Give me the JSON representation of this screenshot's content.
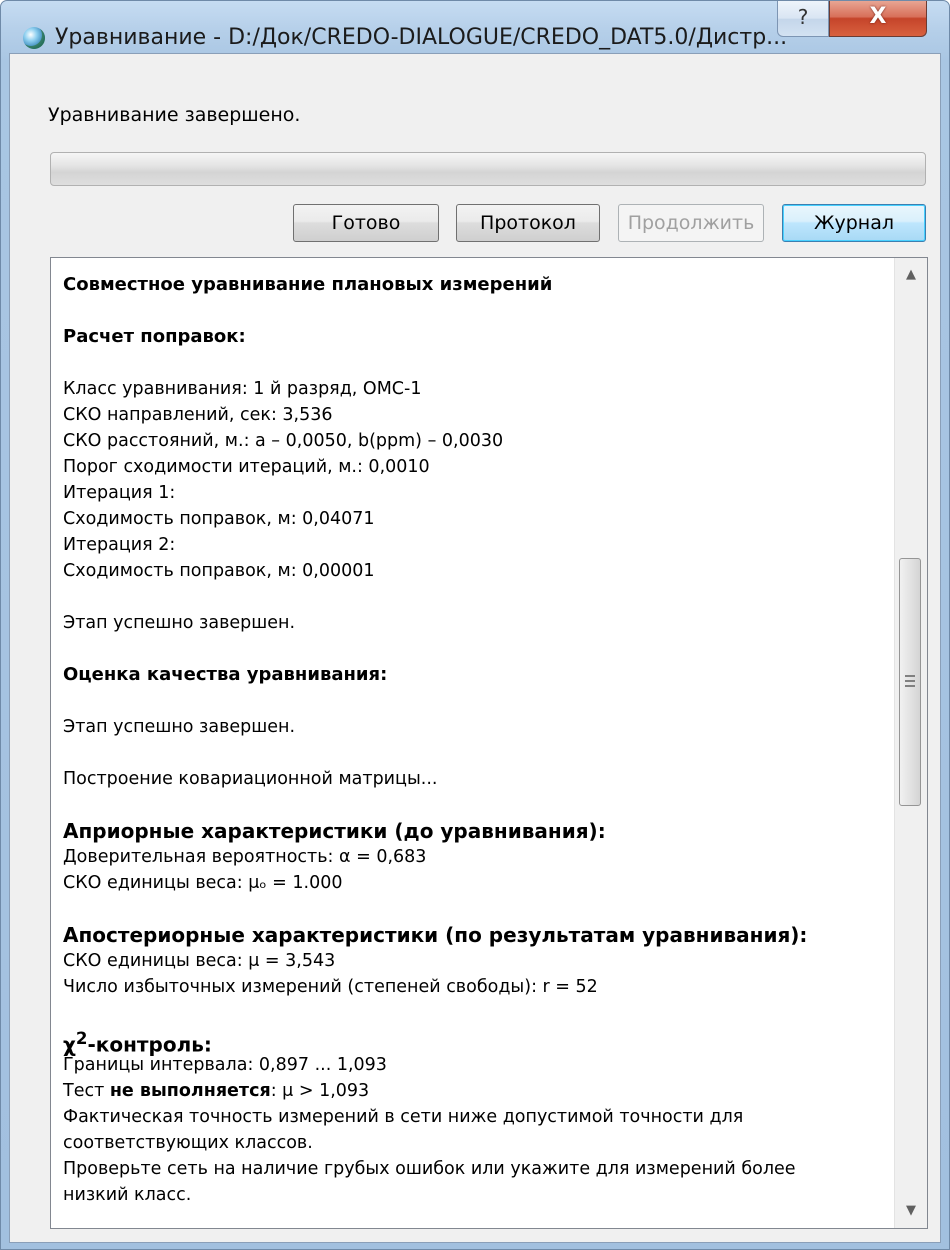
{
  "window": {
    "title": "Уравнивание - D:/Док/CREDO-DIALOGUE/CREDO_DAT5.0/Дистр...",
    "help_glyph": "?",
    "close_glyph": "X",
    "icon": "globe-icon"
  },
  "status": {
    "text": "Уравнивание завершено.",
    "progress_percent": 0
  },
  "buttons": {
    "done": "Готово",
    "protocol": "Протокол",
    "continue": "Продолжить",
    "journal": "Журнал"
  },
  "log": {
    "title": "Совместное уравнивание плановых измерений",
    "corrections_heading": "Расчет поправок:",
    "adjustment_class": "Класс уравнивания: 1 й разряд, ОМС-1",
    "sko_directions": "СКО направлений, сек: 3,536",
    "sko_distances": "СКО расстояний, м.: a – 0,0050, b(ppm) – 0,0030",
    "convergence_threshold": "Порог сходимости итераций, м.: 0,0010",
    "iteration1": "Итерация 1:",
    "convergence1": "Сходимость поправок, м: 0,04071",
    "iteration2": "Итерация 2:",
    "convergence2": "Сходимость поправок, м: 0,00001",
    "stage_done1": "Этап успешно завершен.",
    "quality_heading": "Оценка качества уравнивания:",
    "stage_done2": "Этап успешно завершен.",
    "covariance": "Построение ковариационной матрицы...",
    "apriori_heading": "Априорные характеристики (до уравнивания):",
    "confidence": "Доверительная вероятность: α = 0,683",
    "sko_unit_weight_prior": "СКО единицы веса: μₒ = 1.000",
    "aposteriori_heading": "Апостериорные характеристики (по результатам уравнивания):",
    "sko_unit_weight_post": "СКО единицы веса: μ = 3,543",
    "redundant": "Число избыточных измерений (степеней свободы): r = 52",
    "chi_heading_prefix": "χ",
    "chi_heading_sup": "2",
    "chi_heading_suffix": "-контроль:",
    "interval": "Границы интервала: 0,897 ... 1,093",
    "test_prefix": "Тест ",
    "test_bold": "не выполняется",
    "test_suffix": ": μ > 1,093",
    "note1": "Фактическая точность измерений в сети ниже допустимой точности для",
    "note2": "соответствующих классов.",
    "note3": "Проверьте сеть на наличие грубых ошибок или укажите для измерений более",
    "note4": "низкий класс."
  },
  "scrollbar": {
    "up_glyph": "▲",
    "down_glyph": "▼",
    "up_icon": "scroll-up-arrow-icon",
    "down_icon": "scroll-down-arrow-icon"
  }
}
